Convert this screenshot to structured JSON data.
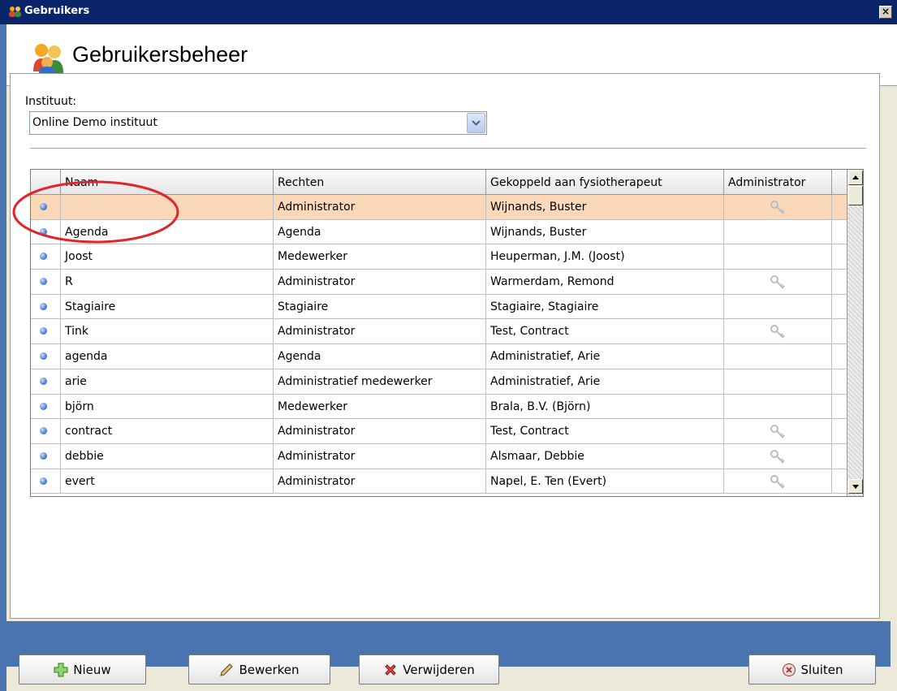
{
  "window": {
    "title": "Gebruikers",
    "close_label": "×"
  },
  "header": {
    "title": "Gebruikersbeheer"
  },
  "instituut": {
    "label": "Instituut:",
    "selected": "Online Demo instituut"
  },
  "table": {
    "columns": [
      "Naam",
      "Rechten",
      "Gekoppeld aan fysiotherapeut",
      "Administrator"
    ],
    "rows": [
      {
        "naam": "",
        "rechten": "Administrator",
        "fysio": "Wijnands, Buster",
        "admin": true,
        "selected": true
      },
      {
        "naam": "Agenda",
        "rechten": "Agenda",
        "fysio": "Wijnands, Buster",
        "admin": false
      },
      {
        "naam": "Joost",
        "rechten": "Medewerker",
        "fysio": "Heuperman, J.M.  (Joost)",
        "admin": false
      },
      {
        "naam": "R",
        "rechten": "Administrator",
        "fysio": "Warmerdam, Remond",
        "admin": true
      },
      {
        "naam": "Stagiaire",
        "rechten": "Stagiaire",
        "fysio": "Stagiaire, Stagiaire",
        "admin": false
      },
      {
        "naam": "Tink",
        "rechten": "Administrator",
        "fysio": "Test, Contract",
        "admin": true
      },
      {
        "naam": "agenda",
        "rechten": "Agenda",
        "fysio": "Administratief, Arie",
        "admin": false
      },
      {
        "naam": "arie",
        "rechten": "Administratief medewerker",
        "fysio": "Administratief, Arie",
        "admin": false
      },
      {
        "naam": "björn",
        "rechten": "Medewerker",
        "fysio": "Brala, B.V.  (Björn)",
        "admin": false
      },
      {
        "naam": "contract",
        "rechten": "Administrator",
        "fysio": "Test, Contract",
        "admin": true
      },
      {
        "naam": "debbie",
        "rechten": "Administrator",
        "fysio": "Alsmaar, Debbie",
        "admin": true
      },
      {
        "naam": "evert",
        "rechten": "Administrator",
        "fysio": "Napel, E. Ten (Evert)",
        "admin": true
      }
    ]
  },
  "buttons": {
    "new": "Nieuw",
    "edit": "Bewerken",
    "delete": "Verwijderen",
    "close": "Sluiten"
  },
  "icons": {
    "row_bullet": "bullet-icon",
    "admin_key": "key-icon",
    "new": "plus-icon",
    "edit": "pencil-icon",
    "delete": "x-icon",
    "close": "close-circle-icon"
  },
  "colors": {
    "titlebar": "#0a246a",
    "footer": "#4a74b0",
    "selected_row": "#fbd8b8",
    "annotation": "#e0262a"
  }
}
